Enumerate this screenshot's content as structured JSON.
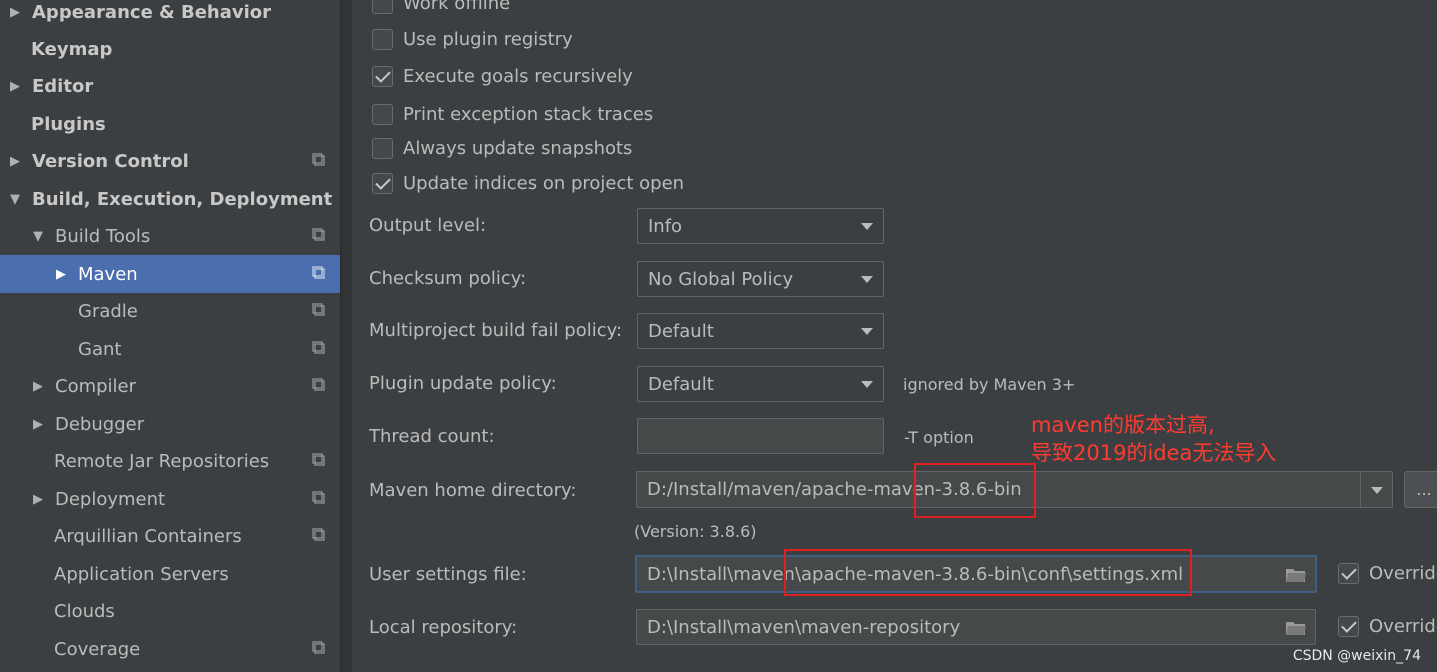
{
  "sidebar": {
    "items": [
      {
        "label": "Appearance & Behavior",
        "arrow": "▶"
      },
      {
        "label": "Keymap"
      },
      {
        "label": "Editor",
        "arrow": "▶"
      },
      {
        "label": "Plugins"
      },
      {
        "label": "Version Control",
        "arrow": "▶"
      },
      {
        "label": "Build, Execution, Deployment",
        "arrow": "▼"
      },
      {
        "label": "Build Tools",
        "arrow": "▼"
      },
      {
        "label": "Maven",
        "arrow": "▶"
      },
      {
        "label": "Gradle"
      },
      {
        "label": "Gant"
      },
      {
        "label": "Compiler",
        "arrow": "▶"
      },
      {
        "label": "Debugger",
        "arrow": "▶"
      },
      {
        "label": "Remote Jar Repositories"
      },
      {
        "label": "Deployment",
        "arrow": "▶"
      },
      {
        "label": "Arquillian Containers"
      },
      {
        "label": "Application Servers"
      },
      {
        "label": "Clouds"
      },
      {
        "label": "Coverage"
      }
    ]
  },
  "options": {
    "work_offline": "Work offline",
    "use_plugin_registry": "Use plugin registry",
    "execute_goals_recursively": "Execute goals recursively",
    "print_exception_stack_traces": "Print exception stack traces",
    "always_update_snapshots": "Always update snapshots",
    "update_indices": "Update indices on project open"
  },
  "fields": {
    "output_level_label": "Output level:",
    "output_level_value": "Info",
    "checksum_label": "Checksum policy:",
    "checksum_value": "No Global Policy",
    "multiproject_label": "Multiproject build fail policy:",
    "multiproject_value": "Default",
    "plugin_update_label": "Plugin update policy:",
    "plugin_update_value": "Default",
    "plugin_update_hint": "ignored by Maven 3+",
    "thread_count_label": "Thread count:",
    "thread_count_value": "",
    "thread_count_hint": "-T option",
    "maven_home_label": "Maven home directory:",
    "maven_home_value": "D:/Install/maven/apache-maven-3.8.6-bin",
    "browse_label": "...",
    "version_text": "(Version: 3.8.6)",
    "user_settings_label": "User settings file:",
    "user_settings_value": "D:\\Install\\maven\\apache-maven-3.8.6-bin\\conf\\settings.xml",
    "local_repo_label": "Local repository:",
    "local_repo_value": "D:\\Install\\maven\\maven-repository",
    "override_label": "Override",
    "override_label_2": "Override"
  },
  "annotation": {
    "line1": "maven的版本过高,",
    "line2": "导致2019的idea无法导入"
  },
  "watermark": "CSDN @weixin_74"
}
